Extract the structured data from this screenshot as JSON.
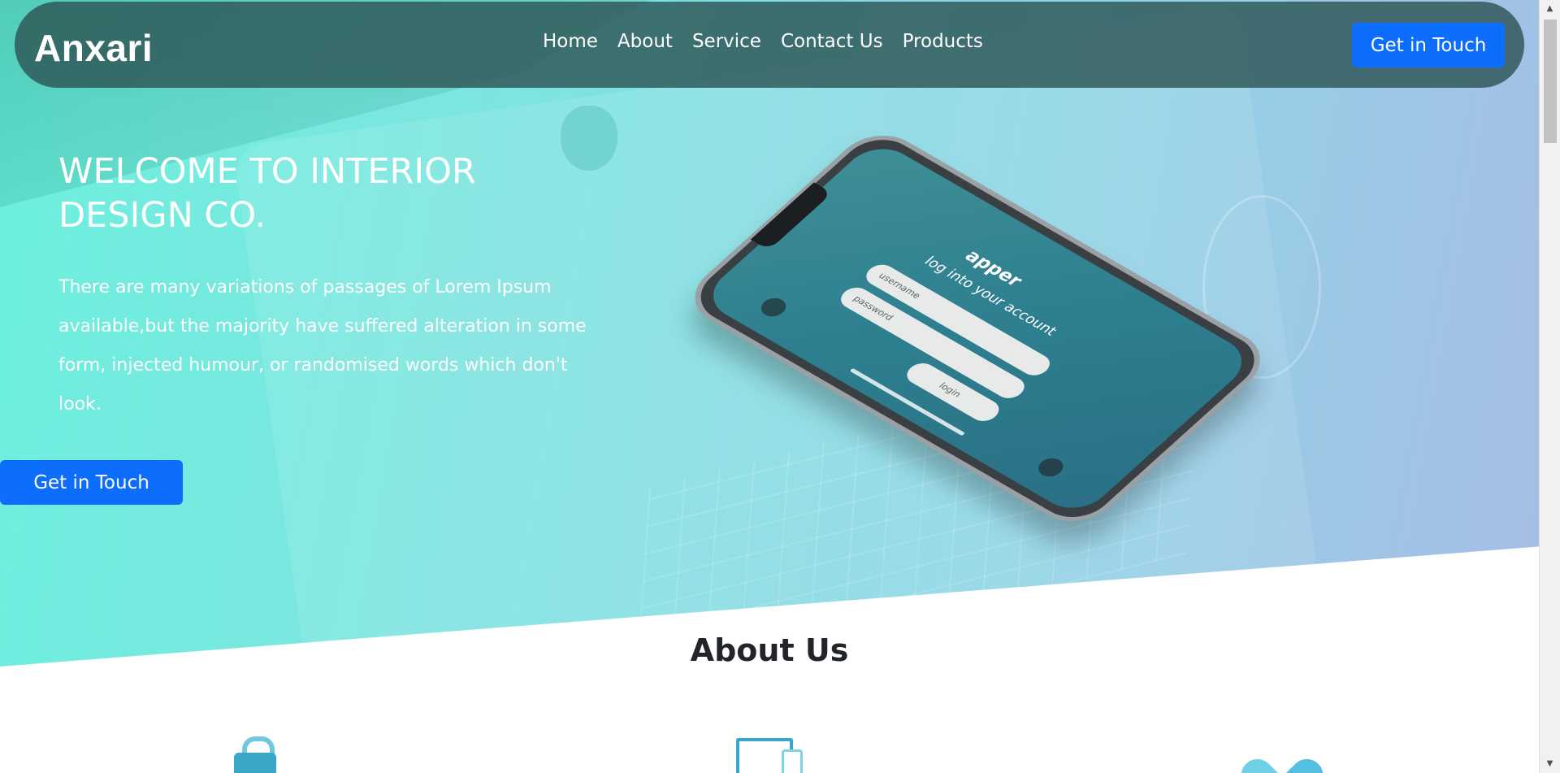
{
  "brand": "Anxari",
  "nav": {
    "links": [
      "Home",
      "About",
      "Service",
      "Contact Us",
      "Products"
    ],
    "cta": "Get in Touch"
  },
  "hero": {
    "title": "WELCOME TO INTERIOR DESIGN CO.",
    "text": "There are many variations of passages of Lorem Ipsum available,but the majority have suffered alteration in some form, injected humour, or randomised words which don't look.",
    "cta": "Get in Touch"
  },
  "phone": {
    "app_title": "apper",
    "app_subtitle": "log into your account",
    "username_placeholder": "username",
    "password_placeholder": "password",
    "login_label": "login"
  },
  "about": {
    "title": "About Us",
    "icons": [
      "lock-icon",
      "devices-icon",
      "heart-icon"
    ]
  },
  "scrollbar": {
    "up_arrow": "▲",
    "down_arrow": "▼"
  },
  "colors": {
    "accent": "#0d6efd",
    "nav_bg": "#2d5555",
    "hero_start": "#6cf0dd",
    "hero_end": "#a6bce6",
    "icon_blue": "#3aa7c9"
  }
}
